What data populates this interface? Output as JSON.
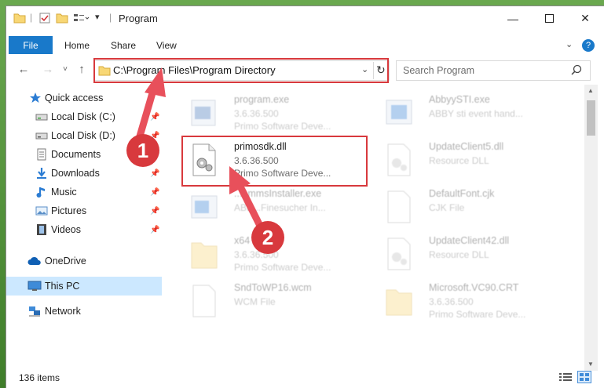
{
  "window": {
    "title": "Program",
    "controls": [
      "minimize",
      "maximize",
      "close"
    ]
  },
  "ribbon": {
    "tabs": [
      {
        "label": "File"
      },
      {
        "label": "Home"
      },
      {
        "label": "Share"
      },
      {
        "label": "View"
      }
    ],
    "help_label": "?"
  },
  "navigation": {
    "address": "C:\\Program Files\\Program Directory",
    "search_placeholder": "Search Program"
  },
  "nav_pane": {
    "items": [
      {
        "label": "Quick access",
        "icon": "star-icon"
      },
      {
        "label": "Local Disk (C:)",
        "icon": "drive-icon",
        "pinned": true
      },
      {
        "label": "Local Disk (D:)",
        "icon": "drive-icon",
        "pinned": true
      },
      {
        "label": "Documents",
        "icon": "documents-icon",
        "pinned": true
      },
      {
        "label": "Downloads",
        "icon": "download-icon",
        "pinned": true
      },
      {
        "label": "Music",
        "icon": "music-icon",
        "pinned": true
      },
      {
        "label": "Pictures",
        "icon": "pictures-icon",
        "pinned": true
      },
      {
        "label": "Videos",
        "icon": "videos-icon",
        "pinned": true
      },
      {
        "label": "OneDrive",
        "icon": "cloud-icon"
      },
      {
        "label": "This PC",
        "icon": "computer-icon",
        "selected": true
      },
      {
        "label": "Network",
        "icon": "network-icon"
      }
    ]
  },
  "files": [
    {
      "name": "program.exe",
      "line2": "3.6.36.500",
      "line3": "Primo Software Deve...",
      "icon": "exe-icon",
      "dimmed": true
    },
    {
      "name": "AbbyySTI.exe",
      "line2": "ABBY sti event hand...",
      "line3": "",
      "icon": "exe-icon",
      "dimmed": true
    },
    {
      "name": "primosdk.dll",
      "line2": "3.6.36.500",
      "line3": "Primo Software Deve...",
      "icon": "dll-gear-icon",
      "dimmed": false
    },
    {
      "name": "UpdateClient5.dll",
      "line2": "Resource DLL",
      "line3": "",
      "icon": "dll-gear-icon",
      "dimmed": true
    },
    {
      "name": "...ammsInstaller.exe",
      "line2": "ABB...Finesucher In...",
      "line3": "",
      "icon": "exe-icon",
      "dimmed": true
    },
    {
      "name": "DefaultFont.cjk",
      "line2": "CJK File",
      "line3": "",
      "icon": "file-icon",
      "dimmed": true
    },
    {
      "name": "x64",
      "line2": "3.6.36.500",
      "line3": "Primo Software Deve...",
      "icon": "folder-file-icon",
      "dimmed": true
    },
    {
      "name": "UpdateClient42.dll",
      "line2": "Resource DLL",
      "line3": "",
      "icon": "dll-gear-icon",
      "dimmed": true
    },
    {
      "name": "SndToWP16.wcm",
      "line2": "WCM File",
      "line3": "",
      "icon": "file-icon",
      "dimmed": true
    },
    {
      "name": "Microsoft.VC90.CRT",
      "line2": "3.6.36.500",
      "line3": "Primo Software Deve...",
      "icon": "folder-file-icon",
      "dimmed": true
    }
  ],
  "annotations": [
    {
      "label": "1",
      "color": "#d8393d"
    },
    {
      "label": "2",
      "color": "#d8393d"
    }
  ],
  "status": {
    "item_count": "136 items"
  }
}
